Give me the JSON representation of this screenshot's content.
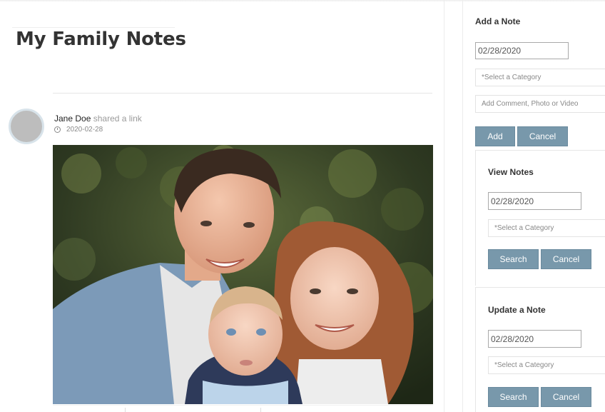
{
  "page": {
    "title": "My Family Notes"
  },
  "post": {
    "author": "Jane Doe",
    "action": "shared a link",
    "date": "2020-02-28"
  },
  "sidebar": {
    "add_note": {
      "title": "Add a Note",
      "date_value": "02/28/2020",
      "category_placeholder": "*Select a Category",
      "comment_placeholder": "Add Comment, Photo or Video",
      "add_label": "Add",
      "cancel_label": "Cancel"
    },
    "view_notes": {
      "title": "View Notes",
      "date_value": "02/28/2020",
      "category_placeholder": "*Select a Category",
      "search_label": "Search",
      "cancel_label": "Cancel"
    },
    "update_note": {
      "title": "Update a Note",
      "date_value": "02/28/2020",
      "category_placeholder": "*Select a Category",
      "search_label": "Search",
      "cancel_label": "Cancel"
    }
  },
  "colors": {
    "button": "#7898ab",
    "avatar_ring": "#d8e3ea"
  }
}
